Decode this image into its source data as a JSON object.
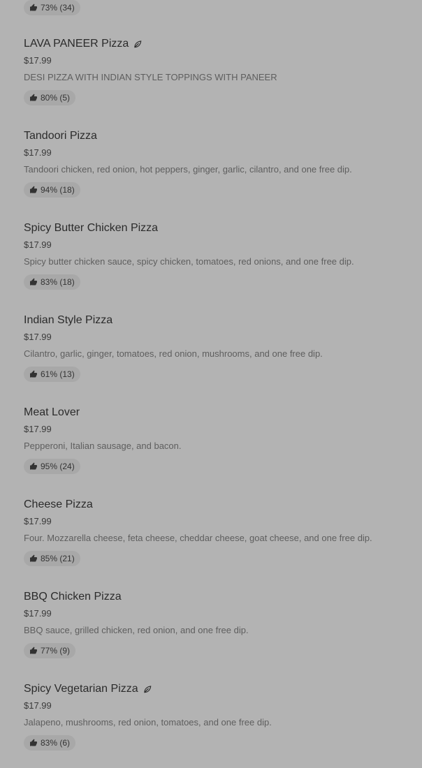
{
  "top_rating": "73% (34)",
  "items": [
    {
      "name": "LAVA PANEER Pizza",
      "vegetarian": true,
      "price": "$17.99",
      "description": "DESI PIZZA WITH INDIAN STYLE TOPPINGS WITH PANEER",
      "rating": "80% (5)"
    },
    {
      "name": "Tandoori Pizza",
      "vegetarian": false,
      "price": "$17.99",
      "description": "Tandoori chicken, red onion, hot peppers, ginger, garlic, cilantro, and one free dip.",
      "rating": "94% (18)"
    },
    {
      "name": "Spicy Butter Chicken Pizza",
      "vegetarian": false,
      "price": "$17.99",
      "description": "Spicy butter chicken sauce, spicy chicken, tomatoes, red onions, and one free dip.",
      "rating": "83% (18)"
    },
    {
      "name": "Indian Style Pizza",
      "vegetarian": false,
      "price": "$17.99",
      "description": "Cilantro, garlic, ginger, tomatoes, red onion, mushrooms, and one free dip.",
      "rating": "61% (13)"
    },
    {
      "name": "Meat Lover",
      "vegetarian": false,
      "price": "$17.99",
      "description": "Pepperoni, Italian sausage, and bacon.",
      "rating": "95% (24)"
    },
    {
      "name": "Cheese Pizza",
      "vegetarian": false,
      "price": "$17.99",
      "description": "Four. Mozzarella cheese, feta cheese, cheddar cheese, goat cheese, and one free dip.",
      "rating": "85% (21)"
    },
    {
      "name": "BBQ Chicken Pizza",
      "vegetarian": false,
      "price": "$17.99",
      "description": "BBQ sauce, grilled chicken, red onion, and one free dip.",
      "rating": "77% (9)"
    },
    {
      "name": "Spicy Vegetarian Pizza",
      "vegetarian": true,
      "price": "$17.99",
      "description": "Jalapeno, mushrooms, red onion, tomatoes, and one free dip.",
      "rating": "83% (6)"
    }
  ]
}
